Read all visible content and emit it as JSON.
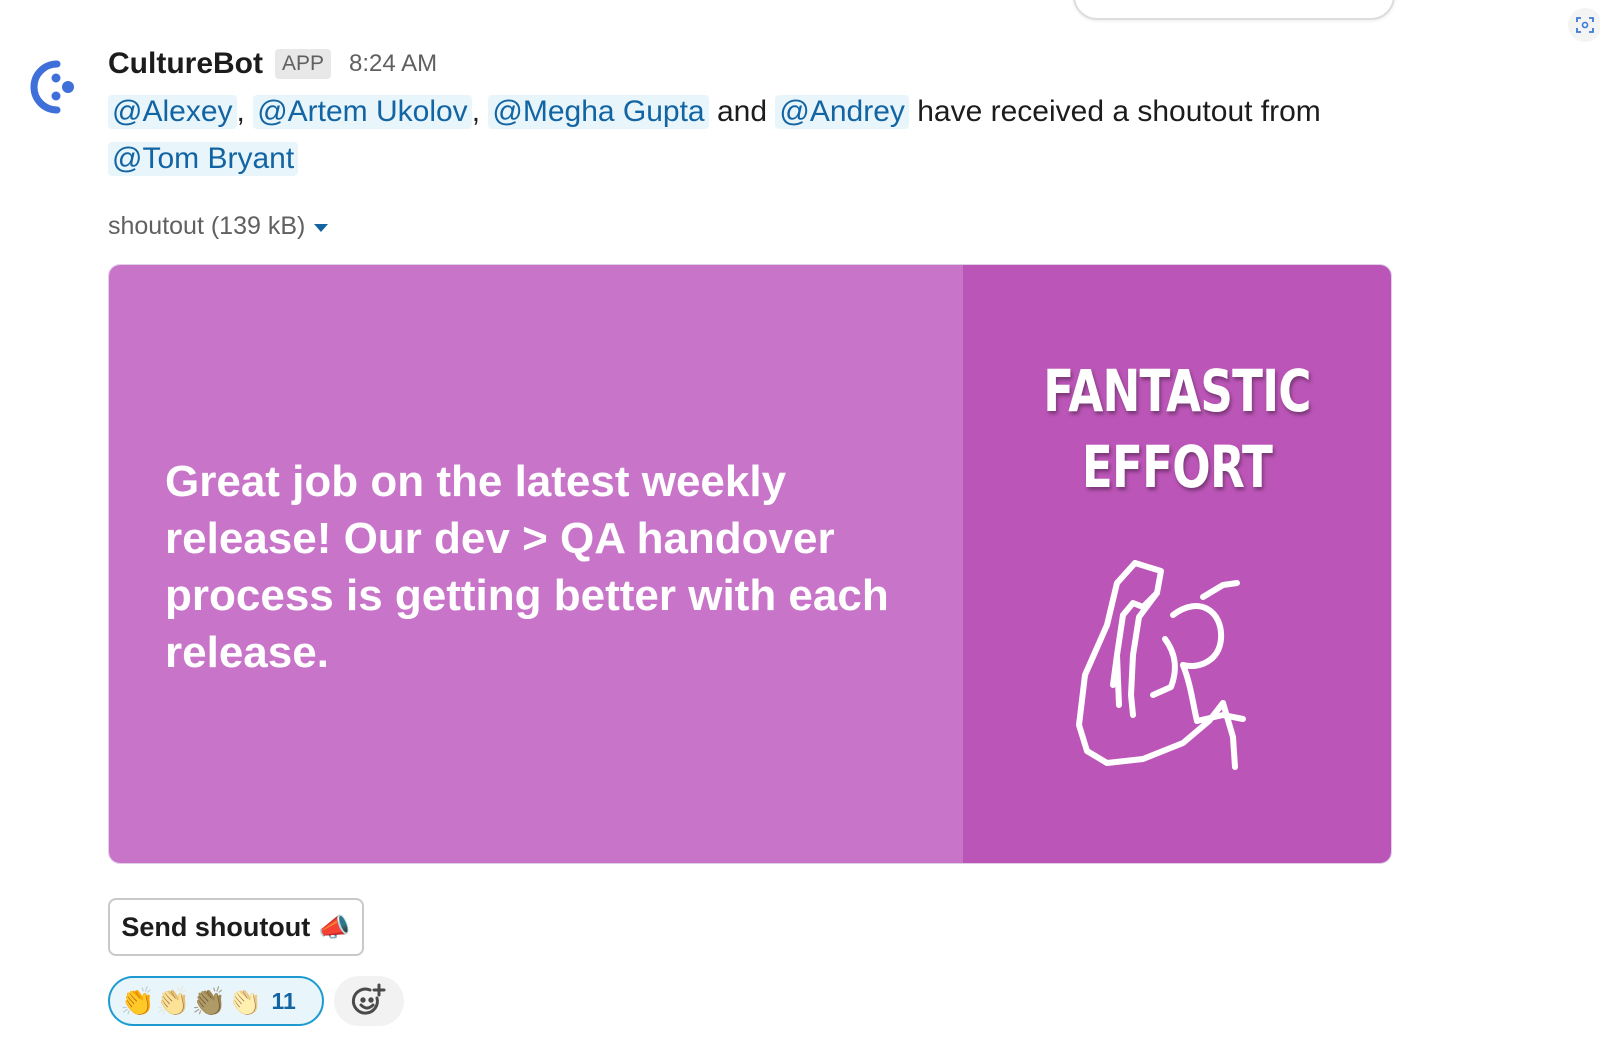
{
  "message": {
    "bot_name": "CultureBot",
    "badge": "APP",
    "time": "8:24 AM",
    "mentions": {
      "m1": "@Alexey",
      "m2": "@Artem Ukolov",
      "m3": "@Megha Gupta",
      "m4": "@Andrey",
      "m5": "@Tom Bryant"
    },
    "sep_comma": ",",
    "word_and": "and",
    "text_tail": "have received a shoutout from"
  },
  "attachment": {
    "label": "shoutout (139 kB)",
    "card_message": "Great job on the latest weekly release! Our dev > QA handover process is getting better with each release.",
    "card_title_line1": "FANTASTIC",
    "card_title_line2": "EFFORT",
    "left_color": "#c874c9",
    "right_color": "#bb55b7"
  },
  "actions": {
    "send_shoutout_label": "Send shoutout",
    "send_shoutout_emoji": "📣"
  },
  "reactions": {
    "emoji": [
      "👏",
      "👏",
      "👏",
      "👏"
    ],
    "count": "11"
  },
  "icons": {
    "avatar": "culturebot-logo-icon",
    "corner": "screenshot-scan-icon",
    "caret": "caret-down-icon",
    "add_reaction": "add-reaction-icon",
    "card_graphic": "flexed-bicep-icon"
  }
}
